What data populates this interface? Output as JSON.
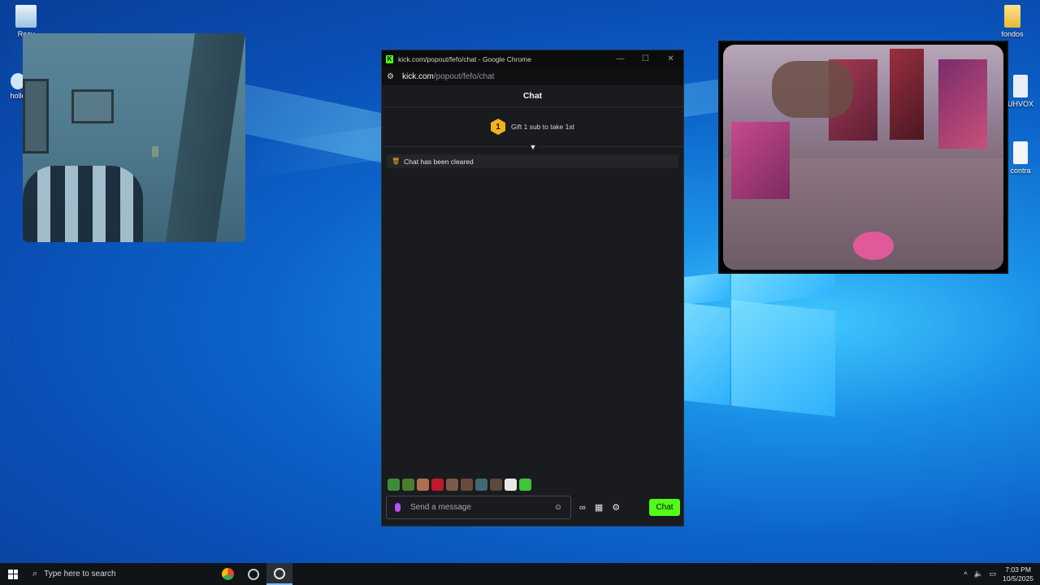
{
  "desktop": {
    "icons": [
      {
        "label": "Recy",
        "name": "recycle-bin-icon"
      },
      {
        "label": "hollo",
        "name": "shortcut-icon"
      },
      {
        "label": "fondos",
        "name": "folder-icon"
      },
      {
        "label": "UHVOX",
        "name": "document-icon"
      },
      {
        "label": "contra",
        "name": "document-icon"
      }
    ]
  },
  "chrome": {
    "title": "kick.com/popout/fefo/chat - Google Chrome",
    "url_host": "kick.com",
    "url_path": "/popout/fefo/chat",
    "controls": [
      "—",
      "☐",
      "✕"
    ]
  },
  "chat": {
    "header": "Chat",
    "gift_rank": "1",
    "gift_text": "Gift 1 sub to take 1st",
    "cleared_text": "Chat has been cleared",
    "placeholder": "Send a message",
    "send_label": "Chat",
    "emote_colors": [
      "#3f8b3a",
      "#4b7d2f",
      "#b07050",
      "#c0192c",
      "#7a5a48",
      "#6a4a3c",
      "#3e6a74",
      "#5a4a3a",
      "#e8e8e8",
      "#3fc43a"
    ]
  },
  "taskbar": {
    "search_placeholder": "Type here to search",
    "time": "7:03 PM",
    "date": "10/5/2025"
  },
  "colors": {
    "kick_green": "#53fc18",
    "gift_gold": "#f2b21b",
    "mic_purple": "#c04ff5"
  }
}
